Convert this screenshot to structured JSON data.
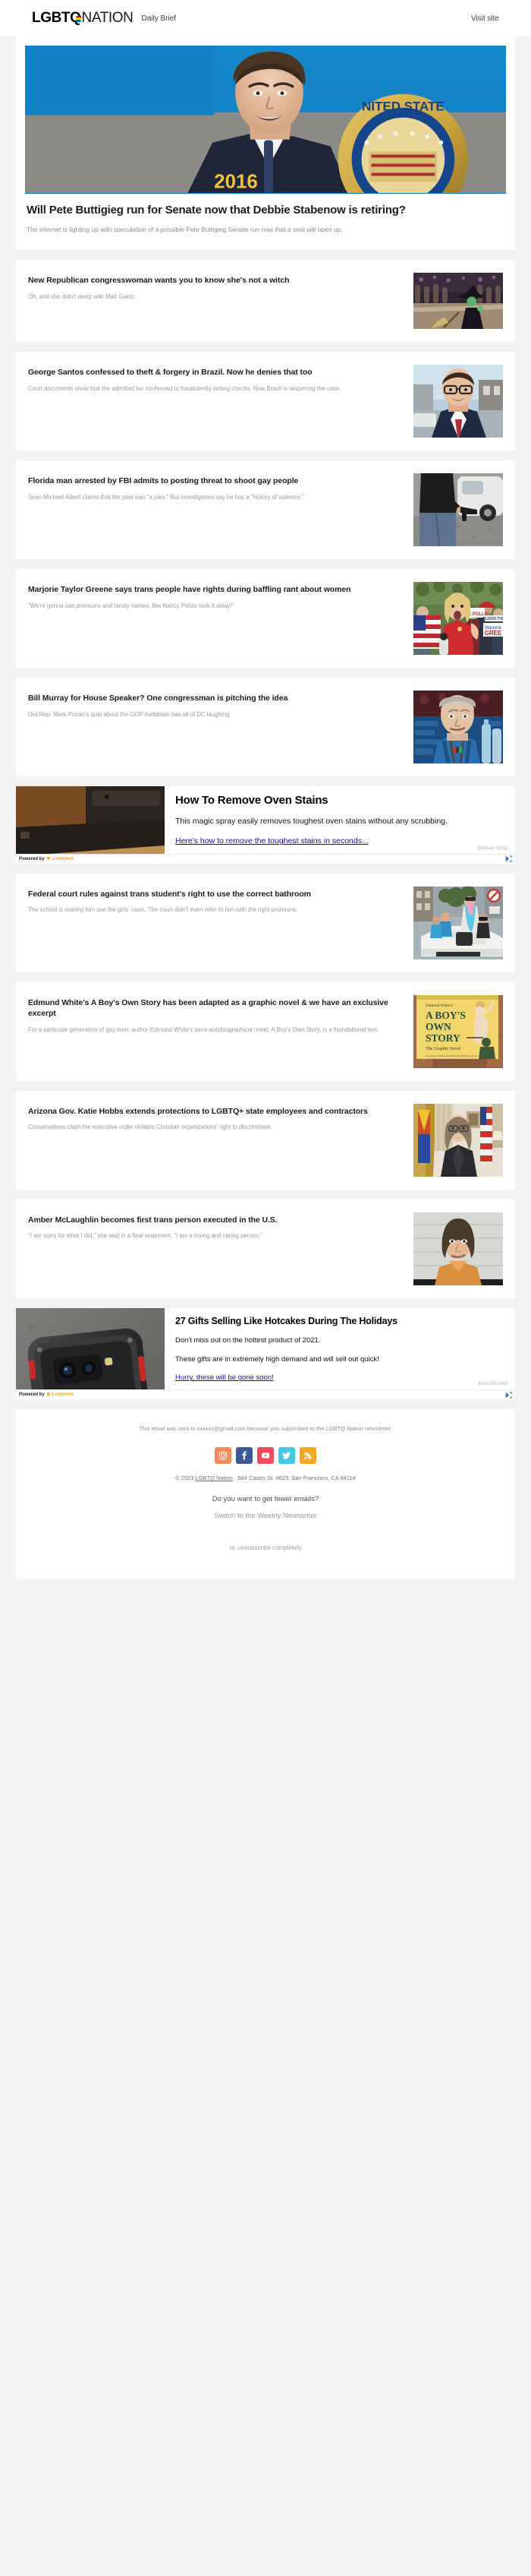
{
  "masthead": {
    "brand_bold": "LGBT",
    "brand_q": "Q",
    "brand_light": "NATION",
    "section_label": "Daily Brief",
    "visit_site": "Visit site"
  },
  "hero": {
    "title": "Will Pete Buttigieg run for Senate now that Debbie Stabenow is retiring?",
    "dek": "The internet is lighting up with speculation of a possible Pete Buttigieg Senate run now that a seat will open up."
  },
  "stories": [
    {
      "title": "New Republican congresswoman wants you to know she's not a witch",
      "dek": "Oh, and she didn't sleep with Matt Gaetz."
    },
    {
      "title": "George Santos confessed to theft & forgery in Brazil. Now he denies that too",
      "dek": "Court documents show that the admitted liar confessed to fraudulently writing checks. Now Brazil is reopening the case."
    },
    {
      "title": "Florida man arrested by FBI admits to posting threat to shoot gay people",
      "dek": "Sean Michael Albert claims that the post was \"a joke.\" But investigators say he has a \"history of violence.\""
    },
    {
      "title": "Marjorie Taylor Greene says trans people have rights during baffling rant about women",
      "dek": "\"We're gonna use pronouns and family names, like Nancy Pelosi took it away!\""
    },
    {
      "title": "Bill Murray for House Speaker? One congressman is pitching the idea",
      "dek": "Out Rep. Mark Pocan's quip about the GOP meltdown has all of DC laughing."
    }
  ],
  "stories_after_ad": [
    {
      "title": "Federal court rules against trans student's right to use the correct bathroom",
      "dek": "The school is making him use the girls' room. The court didn't even refer to him with the right pronouns."
    },
    {
      "title": "Edmund White's A Boy's Own Story has been adapted as a graphic novel & we have an exclusive excerpt",
      "dek": "For a particular generation of gay men, author Edmund White's semi-autobiographical novel, A Boy's Own Story, is a foundational text."
    },
    {
      "title": "Arizona Gov. Katie Hobbs extends protections to LGBTQ+ state employees and contractors",
      "dek": "Conservatives claim the executive order violates Christian organizations' right to discriminate."
    },
    {
      "title": "Amber McLaughlin becomes first trans person executed in the U.S.",
      "dek": "\"I am sorry for what I did,\" she said in a final statement. \"I am a loving and caring person.\""
    }
  ],
  "ad_one": {
    "headline": "How To Remove Oven Stains",
    "body": "This magic spray easily removes toughest oven stains without any scrubbing.",
    "link": "Here's how to remove the toughest stains in seconds...",
    "sponsor": "DrClean Spray",
    "powered_by": "Powered by",
    "network": "LiveIntent"
  },
  "ad_two": {
    "headline": "27 Gifts Selling Like Hotcakes During The Holidays",
    "body_1": "Don't miss out on the hottest product of 2021.",
    "body_2": "These gifts are in extremely high demand and will sell out quick!",
    "link": "Hurry, these will be gone soon!",
    "sponsor": "Best Gifts Hub",
    "powered_by": "Powered by",
    "network": "LiveIntent"
  },
  "footer": {
    "note": "This email was sent to xxxxxx@gmail.com because you subscribed to the LGBTQ Nation newsletter.",
    "social": [
      {
        "name": "instagram",
        "glyph": "▣",
        "color": "#f58b56"
      },
      {
        "name": "facebook",
        "glyph": "f",
        "color": "#3b5998"
      },
      {
        "name": "youtube",
        "glyph": "▶",
        "color": "#f4495d"
      },
      {
        "name": "twitter",
        "glyph": "ᴠ",
        "color": "#45c9e0"
      },
      {
        "name": "rss",
        "glyph": "◔",
        "color": "#f5a623"
      }
    ],
    "copyright_pre": "© 2023 ",
    "copyright_link": "LGBTQ Nation",
    "copyright_post": " · 584 Castro St. #623, San Francisco, CA 94114",
    "fewer_emails_q": "Do you want to get fewer emails?",
    "switch_link": "Switch to the Weekly Newsletter",
    "unsubscribe": "or, unsubscribe completely"
  }
}
